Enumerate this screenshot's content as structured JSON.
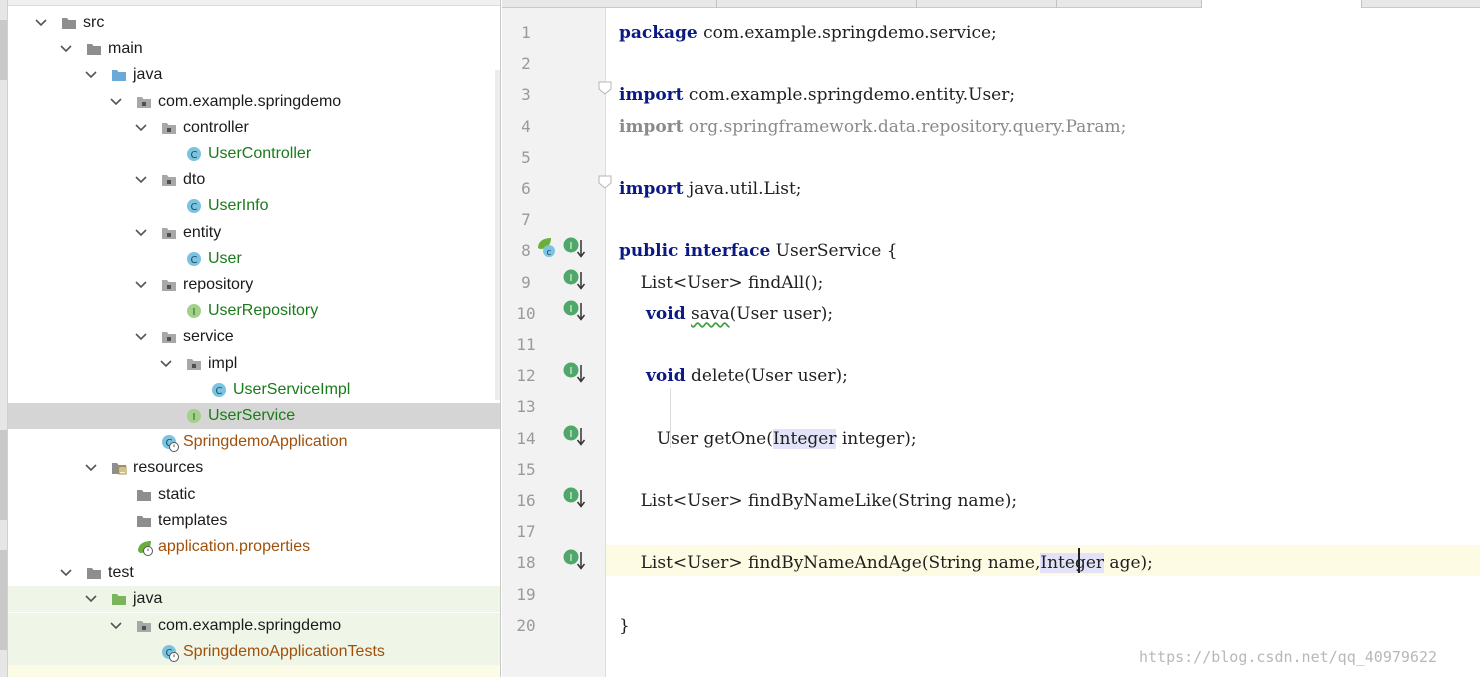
{
  "project_tree": [
    {
      "label": "src",
      "kind": "folder",
      "depth": 0,
      "open": true
    },
    {
      "label": "main",
      "kind": "folder",
      "depth": 1,
      "open": true
    },
    {
      "label": "java",
      "kind": "source-folder",
      "depth": 2,
      "open": true
    },
    {
      "label": "com.example.springdemo",
      "kind": "package",
      "depth": 3,
      "open": true
    },
    {
      "label": "controller",
      "kind": "package",
      "depth": 4,
      "open": true
    },
    {
      "label": "UserController",
      "kind": "class",
      "depth": 5
    },
    {
      "label": "dto",
      "kind": "package",
      "depth": 4,
      "open": true
    },
    {
      "label": "UserInfo",
      "kind": "class",
      "depth": 5
    },
    {
      "label": "entity",
      "kind": "package",
      "depth": 4,
      "open": true
    },
    {
      "label": "User",
      "kind": "class",
      "depth": 5
    },
    {
      "label": "repository",
      "kind": "package",
      "depth": 4,
      "open": true
    },
    {
      "label": "UserRepository",
      "kind": "interface",
      "depth": 5
    },
    {
      "label": "service",
      "kind": "package",
      "depth": 4,
      "open": true
    },
    {
      "label": "impl",
      "kind": "package",
      "depth": 5,
      "open": true
    },
    {
      "label": "UserServiceImpl",
      "kind": "class",
      "depth": 6
    },
    {
      "label": "UserService",
      "kind": "interface",
      "depth": 5,
      "selected": true
    },
    {
      "label": "SpringdemoApplication",
      "kind": "spring-app",
      "depth": 4
    },
    {
      "label": "resources",
      "kind": "resources-folder",
      "depth": 2,
      "open": true
    },
    {
      "label": "static",
      "kind": "folder",
      "depth": 3
    },
    {
      "label": "templates",
      "kind": "folder",
      "depth": 3
    },
    {
      "label": "application.properties",
      "kind": "spring-properties",
      "depth": 3
    },
    {
      "label": "test",
      "kind": "folder",
      "depth": 1,
      "open": true
    },
    {
      "label": "java",
      "kind": "test-folder",
      "depth": 2,
      "open": true,
      "test": true
    },
    {
      "label": "com.example.springdemo",
      "kind": "package",
      "depth": 3,
      "open": true,
      "test": true
    },
    {
      "label": "SpringdemoApplicationTests",
      "kind": "spring-test",
      "depth": 4,
      "test": true
    }
  ],
  "editor": {
    "current_line": 18,
    "lines": [
      {
        "n": "1",
        "segs": [
          [
            "kw",
            "package"
          ],
          [
            "",
            " com.example.springdemo.service;"
          ]
        ]
      },
      {
        "n": "2",
        "segs": []
      },
      {
        "n": "3",
        "segs": [
          [
            "kw",
            "import"
          ],
          [
            "",
            " com.example.springdemo.entity.User;"
          ]
        ],
        "fold": true
      },
      {
        "n": "4",
        "segs": [
          [
            "kw dim",
            "import"
          ],
          [
            "dim",
            " org.springframework.data.repository.query.Param;"
          ]
        ]
      },
      {
        "n": "5",
        "segs": []
      },
      {
        "n": "6",
        "segs": [
          [
            "kw",
            "import"
          ],
          [
            "",
            " java.util.List;"
          ]
        ],
        "fold": true
      },
      {
        "n": "7",
        "segs": []
      },
      {
        "n": "8",
        "segs": [
          [
            "kw",
            "public interface"
          ],
          [
            "",
            " UserService {"
          ]
        ],
        "icons": [
          "spring-bean-icon",
          "implemented-interface-icon"
        ]
      },
      {
        "n": "9",
        "segs": [
          [
            "",
            "    List<User> findAll();"
          ]
        ],
        "icons": [
          "implemented-method-icon"
        ]
      },
      {
        "n": "10",
        "segs": [
          [
            "",
            "     "
          ],
          [
            "kw",
            "void"
          ],
          [
            "",
            " "
          ],
          [
            "squig",
            "sava"
          ],
          [
            "",
            "(User user);"
          ]
        ],
        "icons": [
          "implemented-method-icon"
        ]
      },
      {
        "n": "11",
        "segs": []
      },
      {
        "n": "12",
        "segs": [
          [
            "",
            "     "
          ],
          [
            "kw",
            "void"
          ],
          [
            "",
            " delete(User user);"
          ]
        ],
        "icons": [
          "implemented-method-icon"
        ]
      },
      {
        "n": "13",
        "segs": []
      },
      {
        "n": "14",
        "segs": [
          [
            "",
            "       User getOne("
          ],
          [
            "hl",
            "Integer"
          ],
          [
            "",
            " integer);"
          ]
        ],
        "icons": [
          "implemented-method-icon"
        ]
      },
      {
        "n": "15",
        "segs": []
      },
      {
        "n": "16",
        "segs": [
          [
            "",
            "    List<User> findByNameLike(String name);"
          ]
        ],
        "icons": [
          "implemented-method-icon"
        ]
      },
      {
        "n": "17",
        "segs": []
      },
      {
        "n": "18",
        "segs": [
          [
            "",
            "    List<User> findByNameAndAge(String name,"
          ],
          [
            "hl",
            "Integer"
          ],
          [
            "",
            " age);"
          ]
        ],
        "icons": [
          "implemented-method-icon"
        ]
      },
      {
        "n": "19",
        "segs": []
      },
      {
        "n": "20",
        "segs": [
          [
            "",
            "}"
          ]
        ]
      }
    ]
  },
  "watermark": "https://blog.csdn.net/qq_40979622",
  "colors": {
    "keyword": "#0a1a82",
    "class_name": "#1a7b1a",
    "spring_file": "#a0500a",
    "selection": "#d5d5d5",
    "current_line": "#fdfbe3",
    "identifier_highlight": "#e2e2f8",
    "test_background": "#eff6e8"
  }
}
